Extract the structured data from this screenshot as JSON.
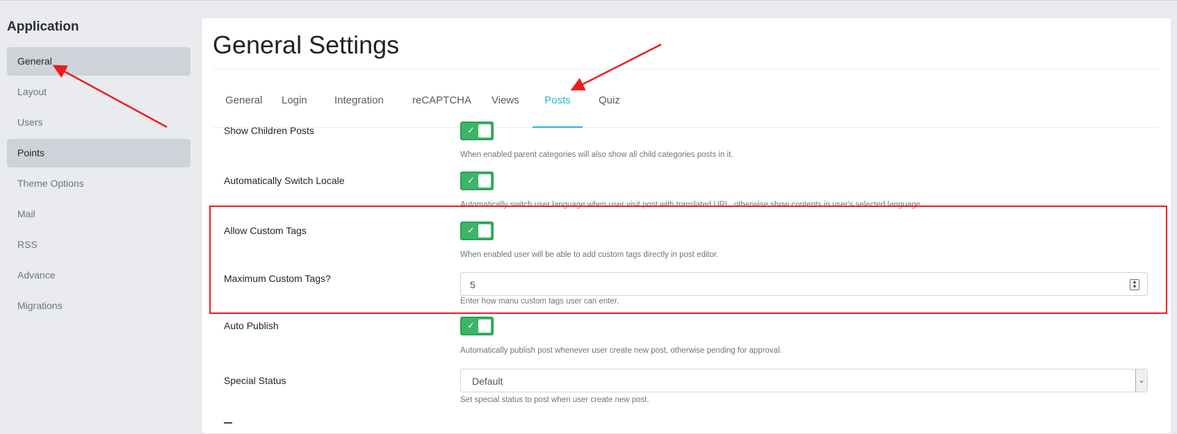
{
  "sidebar": {
    "title": "Application",
    "items": [
      {
        "label": "General",
        "active": true
      },
      {
        "label": "Layout",
        "active": false
      },
      {
        "label": "Users",
        "active": false
      },
      {
        "label": "Points",
        "active": true
      },
      {
        "label": "Theme Options",
        "active": false
      },
      {
        "label": "Mail",
        "active": false
      },
      {
        "label": "RSS",
        "active": false
      },
      {
        "label": "Advance",
        "active": false
      },
      {
        "label": "Migrations",
        "active": false
      }
    ]
  },
  "main": {
    "title": "General Settings",
    "tabs": [
      {
        "label": "General"
      },
      {
        "label": "Login"
      },
      {
        "label": "Integration"
      },
      {
        "label": "reCAPTCHA"
      },
      {
        "label": "Views"
      },
      {
        "label": "Posts",
        "active": true
      },
      {
        "label": "Quiz"
      }
    ],
    "settings": {
      "show_children_posts": {
        "label": "Show Children Posts",
        "enabled": true,
        "help": "When enabled parent categories will also show all child categories posts in it."
      },
      "auto_switch_locale": {
        "label": "Automatically Switch Locale",
        "enabled": true,
        "help": "Automatically switch user language when user visit post with translated URL, otherwise show contents in user's selected language."
      },
      "allow_custom_tags": {
        "label": "Allow Custom Tags",
        "enabled": true,
        "help": "When enabled user will be able to add custom tags directly in post editor."
      },
      "max_custom_tags": {
        "label": "Maximum Custom Tags?",
        "value": "5",
        "help": "Enter how manu custom tags user can enter."
      },
      "auto_publish": {
        "label": "Auto Publish",
        "enabled": true,
        "help": "Automatically publish post whenever user create new post, otherwise pending for approval."
      },
      "special_status": {
        "label": "Special Status",
        "value": "Default",
        "help": "Set special status to post when user create new post."
      }
    }
  },
  "icons": {
    "toggle_check": "✓",
    "spinner_up": "▲",
    "spinner_down": "▼",
    "select_caret": "⌄"
  },
  "colors": {
    "accent": "#2bb3d4",
    "toggle_on": "#3cb568",
    "annotation": "#ee1c1c"
  }
}
